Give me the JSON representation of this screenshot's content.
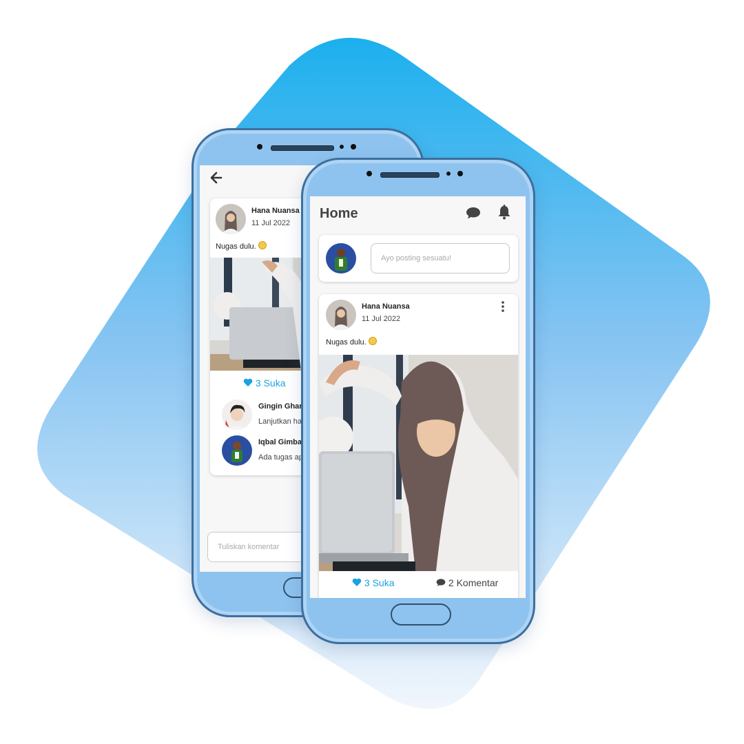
{
  "colors": {
    "accent": "#1aa3e0",
    "phone_body": "#8fc3ef",
    "backdrop_top": "#1cb0ee",
    "backdrop_bottom": "#e9f1fb"
  },
  "detail_screen": {
    "back_icon": "arrow-left-icon",
    "post": {
      "author": "Hana Nuansa",
      "date": "11 Jul 2022",
      "caption": "Nugas dulu."
    },
    "likes": {
      "icon": "heart-icon",
      "label": "3 Suka"
    },
    "comments": [
      {
        "author": "Gingin Ghani",
        "text": "Lanjutkan hal"
      },
      {
        "author": "Iqbal Gimbal",
        "text": "Ada tugas ap"
      }
    ],
    "comment_input": {
      "placeholder": "Tuliskan komentar"
    }
  },
  "home_screen": {
    "title": "Home",
    "icons": {
      "chat": "chat-bubble-icon",
      "bell": "bell-icon",
      "menu": "more-vertical-icon"
    },
    "composer": {
      "placeholder": "Ayo posting sesuatu!"
    },
    "post": {
      "author": "Hana Nuansa",
      "date": "11 Jul 2022",
      "caption": "Nugas dulu."
    },
    "likes": {
      "icon": "heart-icon",
      "label": "3 Suka"
    },
    "comments": {
      "icon": "chat-bubble-icon",
      "label": "2 Komentar"
    }
  }
}
